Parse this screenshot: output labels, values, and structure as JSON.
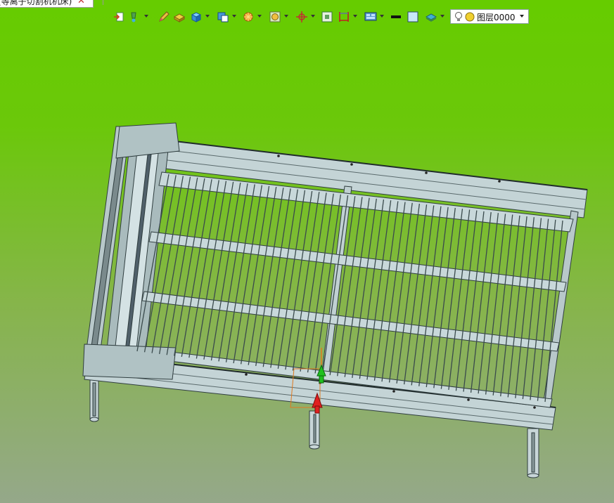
{
  "document_tab": {
    "title": "(等离子切割机机床)",
    "close_glyph": "✕"
  },
  "toolbar": {
    "icons": [
      "export-icon",
      "paint-icon",
      "pencil-icon",
      "cube-yellow-icon",
      "cube-blue-icon",
      "view-icon",
      "sun-icon",
      "box-face-icon",
      "axis-icon",
      "frame-icon",
      "dimension-icon",
      "display-icon",
      "line-color-icon",
      "fill-color-icon",
      "layer-display-icon"
    ]
  },
  "layer": {
    "name": "图层0000",
    "icons": [
      "lightbulb-icon",
      "sphere-icon"
    ]
  },
  "colors": {
    "bg_top": "#66cc00",
    "bg_bottom": "#95a88a",
    "model_fill": "#c4d4d6",
    "model_edge": "#3a4a4c",
    "axis_red": "#e02020",
    "axis_green": "#20c020",
    "axis_orange": "#e07a20"
  }
}
